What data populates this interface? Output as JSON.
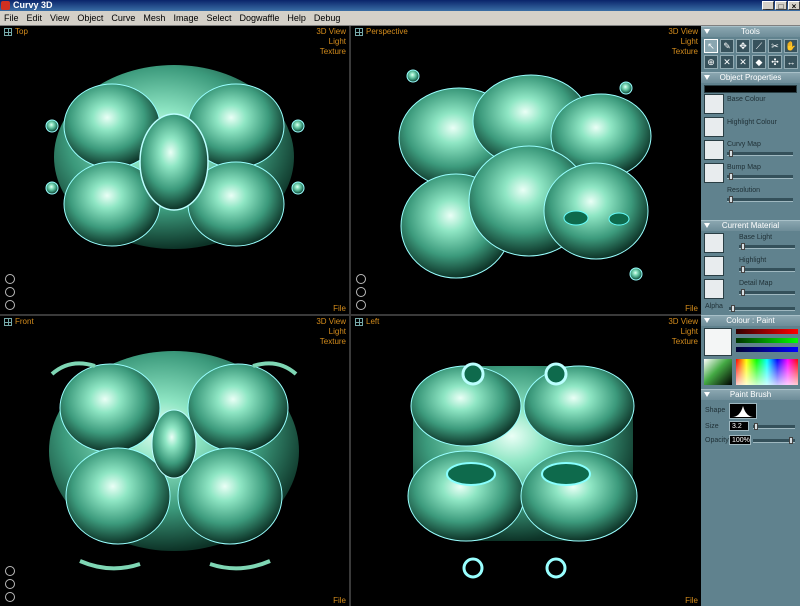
{
  "app": {
    "title": "Curvy 3D"
  },
  "window": {
    "minimize": "_",
    "maximize": "□",
    "close": "×"
  },
  "menu": [
    "File",
    "Edit",
    "View",
    "Object",
    "Curve",
    "Mesh",
    "Image",
    "Select",
    "Dogwaffle",
    "Help",
    "Debug"
  ],
  "viewports": {
    "top": {
      "name": "Top",
      "options": [
        "3D View",
        "Light",
        "Texture"
      ],
      "file": "File"
    },
    "perspective": {
      "name": "Perspective",
      "options": [
        "3D View",
        "Light",
        "Texture"
      ],
      "file": "File"
    },
    "front": {
      "name": "Front",
      "options": [
        "3D View",
        "Light",
        "Texture"
      ],
      "file": "File"
    },
    "left": {
      "name": "Left",
      "options": [
        "3D View",
        "Light",
        "Texture"
      ],
      "file": "File"
    }
  },
  "panel": {
    "tools": {
      "header": "Tools"
    },
    "object_properties": {
      "header": "Object Properties",
      "base_colour": "Base Colour",
      "highlight_colour": "Highlight Colour",
      "curvy_map": "Curvy Map",
      "bump_map": "Bump Map",
      "resolution": "Resolution"
    },
    "current_material": {
      "header": "Current Material",
      "base_light": "Base Light",
      "highlight": "Highlight",
      "detail_map": "Detail Map",
      "alpha": "Alpha"
    },
    "colour": {
      "header": "Colour",
      "mode": "Paint"
    },
    "paint_brush": {
      "header": "Paint Brush",
      "shape_label": "Shape",
      "size_label": "Size",
      "size_value": "3.2",
      "opacity_label": "Opacity",
      "opacity_value": "100%"
    }
  },
  "colors": {
    "viewport_text": "#d48c1c",
    "panel_bg": "#60828e",
    "model": "#5cc4a0"
  }
}
